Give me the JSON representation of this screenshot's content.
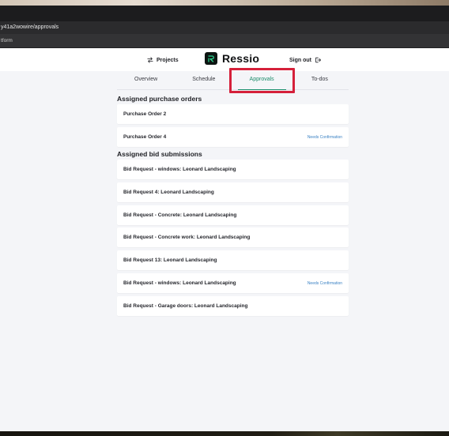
{
  "browser": {
    "url": "y41a2wowire/approvals",
    "bookmark": "tform"
  },
  "header": {
    "projects_label": "Projects",
    "brand_name": "Ressio",
    "signout_label": "Sign out"
  },
  "tabs": [
    {
      "label": "Overview",
      "active": false
    },
    {
      "label": "Schedule",
      "active": false
    },
    {
      "label": "Approvals",
      "active": true
    },
    {
      "label": "To-dos",
      "active": false
    }
  ],
  "purchase_orders": {
    "title": "Assigned purchase orders",
    "items": [
      {
        "title": "Purchase Order 2",
        "badge": ""
      },
      {
        "title": "Purchase Order 4",
        "badge": "Needs Confirmation"
      }
    ]
  },
  "bid_submissions": {
    "title": "Assigned bid submissions",
    "items": [
      {
        "title": "Bid Request - windows: Leonard Landscaping",
        "badge": ""
      },
      {
        "title": "Bid Request 4: Leonard Landscaping",
        "badge": ""
      },
      {
        "title": "Bid Request - Concrete: Leonard Landscaping",
        "badge": ""
      },
      {
        "title": "Bid Request - Concrete work: Leonard Landscaping",
        "badge": ""
      },
      {
        "title": "Bid Request 13: Leonard Landscaping",
        "badge": ""
      },
      {
        "title": "Bid Request - windows: Leonard Landscaping",
        "badge": "Needs Confirmation"
      },
      {
        "title": "Bid Request - Garage doors: Leonard Landscaping",
        "badge": ""
      }
    ]
  },
  "colors": {
    "accent": "#1c8c6a",
    "badge": "#3b82c4",
    "highlight": "#d5203a"
  }
}
